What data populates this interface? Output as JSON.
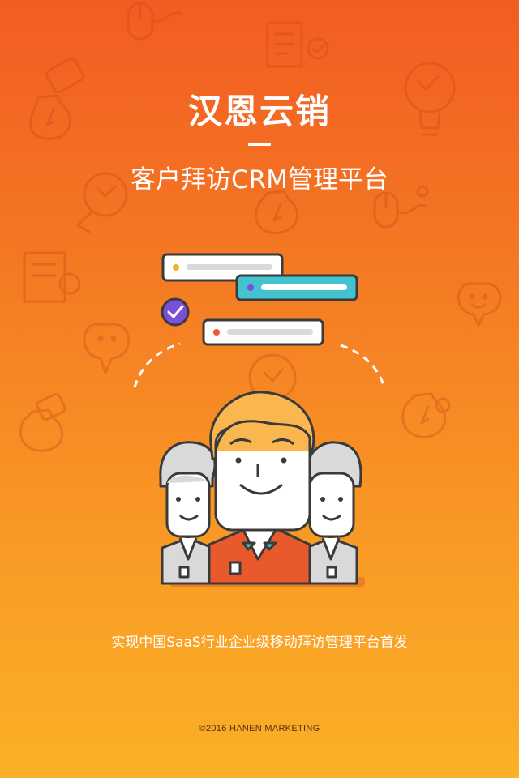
{
  "splash": {
    "title": "汉恩云销",
    "subtitle": "客户拜访CRM管理平台",
    "tagline": "实现中国SaaS行业企业级移动拜访管理平台首发",
    "copyright": "©2016 HANEN MARKETING"
  },
  "colors": {
    "background_top": "#f25c22",
    "background_bottom": "#fbb027",
    "text": "#ffffff",
    "card_highlight": "#45c2cf",
    "check_badge": "#7b4fd6",
    "hair": "#fab64f",
    "shirt_center": "#e8592b"
  },
  "icons": [
    "mouse-icon",
    "receipt-icon",
    "money-bag-icon",
    "lightbulb-icon",
    "chat-bubble-icon",
    "check-badge-icon"
  ]
}
